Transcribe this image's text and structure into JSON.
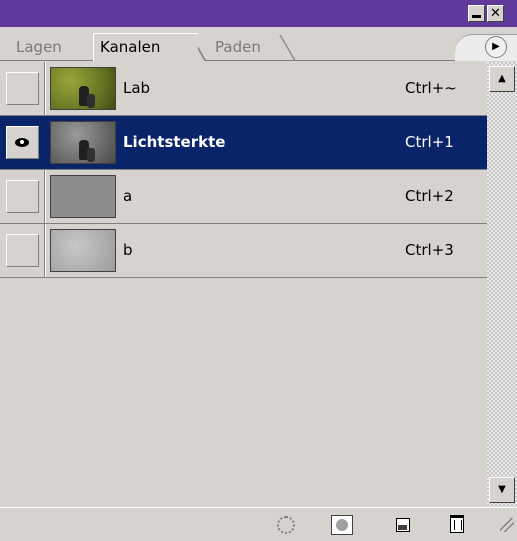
{
  "window": {
    "minimize_label": "",
    "close_label": "✕"
  },
  "tabs": [
    {
      "label": "Lagen"
    },
    {
      "label": "Kanalen"
    },
    {
      "label": "Paden"
    }
  ],
  "menu_icon": "▶",
  "channels": [
    {
      "name": "Lab",
      "shortcut": "Ctrl+~",
      "visible": false,
      "selected": false
    },
    {
      "name": "Lichtsterkte",
      "shortcut": "Ctrl+1",
      "visible": true,
      "selected": true
    },
    {
      "name": "a",
      "shortcut": "Ctrl+2",
      "visible": false,
      "selected": false
    },
    {
      "name": "b",
      "shortcut": "Ctrl+3",
      "visible": false,
      "selected": false
    }
  ],
  "scrollbar": {
    "up_icon": "▲",
    "down_icon": "▼"
  },
  "colors": {
    "titlebar": "#5f3a9b",
    "selection": "#0a246a",
    "panel": "#d6d3ce"
  },
  "icons": [
    "selection-circle-icon",
    "mask-icon",
    "new-channel-icon",
    "trash-icon"
  ]
}
